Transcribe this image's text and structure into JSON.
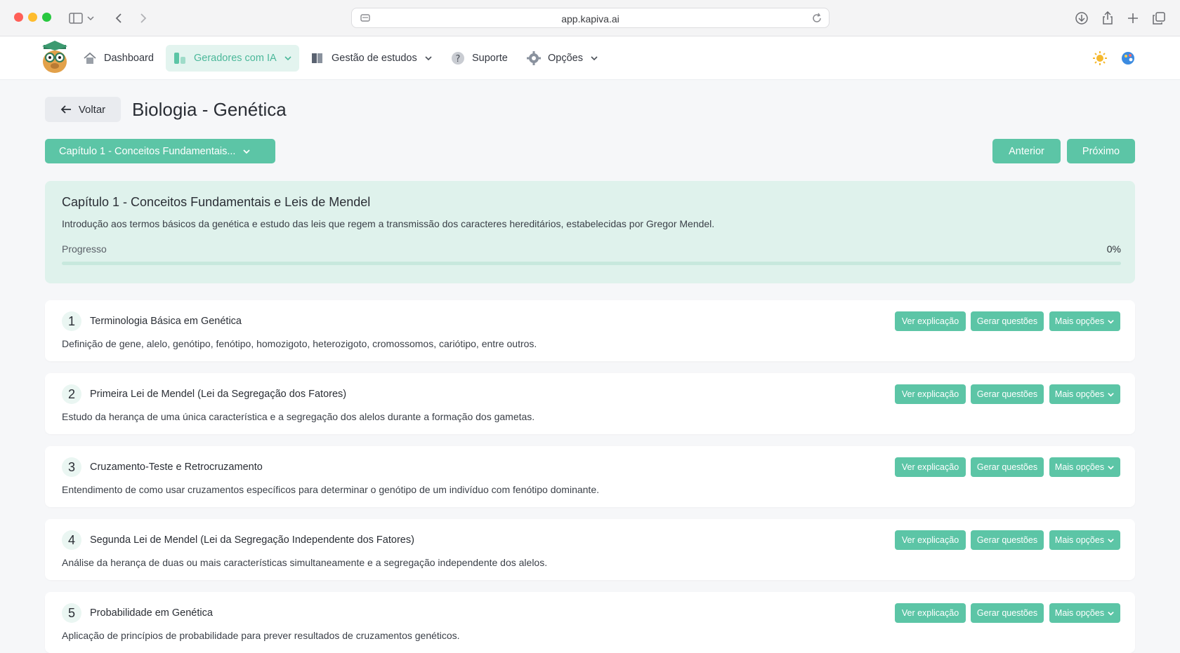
{
  "browser": {
    "url": "app.kapiva.ai"
  },
  "nav": {
    "items": [
      {
        "label": "Dashboard",
        "icon": "home-icon"
      },
      {
        "label": "Geradores com IA",
        "icon": "ai-generator-icon"
      },
      {
        "label": "Gestão de estudos",
        "icon": "books-icon"
      },
      {
        "label": "Suporte",
        "icon": "help-icon"
      },
      {
        "label": "Opções",
        "icon": "gear-icon"
      }
    ],
    "right_icons": [
      "sun-icon",
      "palette-icon"
    ]
  },
  "header": {
    "back_label": "Voltar",
    "title": "Biologia - Genética"
  },
  "chapter_select": {
    "value": "Capítulo 1 - Conceitos Fundamentais..."
  },
  "pager": {
    "prev_label": "Anterior",
    "next_label": "Próximo"
  },
  "chapter": {
    "title": "Capítulo 1 - Conceitos Fundamentais e Leis de Mendel",
    "description": "Introdução aos termos básicos da genética e estudo das leis que regem a transmissão dos caracteres hereditários, estabelecidas por Gregor Mendel.",
    "progress_label": "Progresso",
    "progress_text": "0%",
    "progress_fraction": 0
  },
  "topic_actions": {
    "explain": "Ver explicação",
    "generate": "Gerar questões",
    "more": "Mais opções"
  },
  "topics": [
    {
      "number": "1",
      "title": "Terminologia Básica em Genética",
      "description": "Definição de gene, alelo, genótipo, fenótipo, homozigoto, heterozigoto, cromossomos, cariótipo, entre outros."
    },
    {
      "number": "2",
      "title": "Primeira Lei de Mendel (Lei da Segregação dos Fatores)",
      "description": "Estudo da herança de uma única característica e a segregação dos alelos durante a formação dos gametas."
    },
    {
      "number": "3",
      "title": "Cruzamento-Teste e Retrocruzamento",
      "description": "Entendimento de como usar cruzamentos específicos para determinar o genótipo de um indivíduo com fenótipo dominante."
    },
    {
      "number": "4",
      "title": "Segunda Lei de Mendel (Lei da Segregação Independente dos Fatores)",
      "description": "Análise da herança de duas ou mais características simultaneamente e a segregação independente dos alelos."
    },
    {
      "number": "5",
      "title": "Probabilidade em Genética",
      "description": "Aplicação de princípios de probabilidade para prever resultados de cruzamentos genéticos."
    }
  ],
  "colors": {
    "accent": "#5cc5a6",
    "accent_light": "#dff2ec",
    "page_bg": "#f6f7f9"
  }
}
